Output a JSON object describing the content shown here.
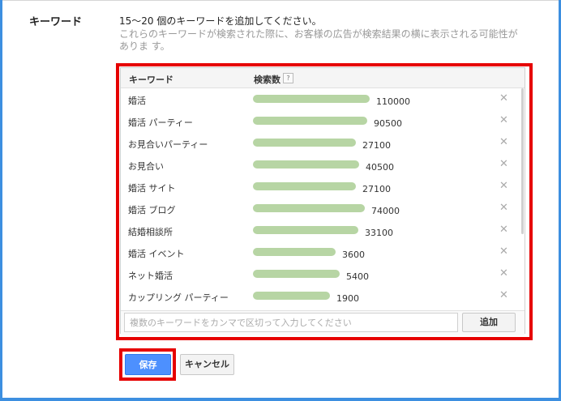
{
  "section": {
    "label": "キーワード"
  },
  "instructions": {
    "main": "15～20 個のキーワードを追加してください。",
    "hint": "これらのキーワードが検索された際に、お客様の広告が検索結果の横に表示される可能性がありま す。"
  },
  "table": {
    "columns": {
      "keyword": "キーワード",
      "volume": "検索数",
      "help": "?"
    },
    "remove_glyph": "✕",
    "rows": [
      {
        "keyword": "婚活",
        "volume": "110000",
        "bar_fraction": 1.0
      },
      {
        "keyword": "婚活 パーティー",
        "volume": "90500",
        "bar_fraction": 0.98
      },
      {
        "keyword": "お見合いパーティー",
        "volume": "27100",
        "bar_fraction": 0.88
      },
      {
        "keyword": "お見合い",
        "volume": "40500",
        "bar_fraction": 0.91
      },
      {
        "keyword": "婚活 サイト",
        "volume": "27100",
        "bar_fraction": 0.88
      },
      {
        "keyword": "婚活 ブログ",
        "volume": "74000",
        "bar_fraction": 0.96
      },
      {
        "keyword": "結婚相談所",
        "volume": "33100",
        "bar_fraction": 0.9
      },
      {
        "keyword": "婚活 イベント",
        "volume": "3600",
        "bar_fraction": 0.71
      },
      {
        "keyword": "ネット婚活",
        "volume": "5400",
        "bar_fraction": 0.74
      },
      {
        "keyword": "カップリング パーティー",
        "volume": "1900",
        "bar_fraction": 0.66
      }
    ]
  },
  "input": {
    "placeholder": "複数のキーワードをカンマで区切って入力してください",
    "value": ""
  },
  "buttons": {
    "add": "追加",
    "save": "保存",
    "cancel": "キャンセル"
  },
  "colors": {
    "accent_red": "#e60000",
    "bar_green": "#b7d5a4",
    "save_blue": "#4d90fe",
    "frame_blue": "#3d8fe0"
  }
}
